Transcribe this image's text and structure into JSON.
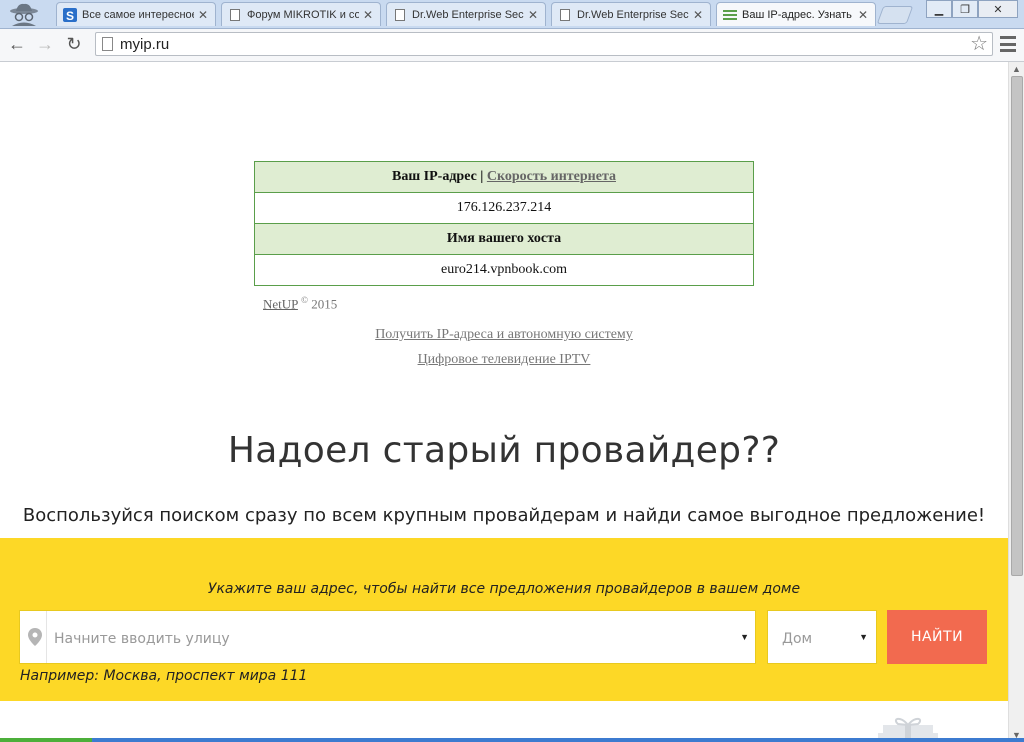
{
  "browser": {
    "tabs": [
      {
        "label": "Все самое интересное",
        "icon": "s-logo-icon",
        "active": false
      },
      {
        "label": "Форум MIKROTIK и со",
        "icon": "page-icon",
        "active": false
      },
      {
        "label": "Dr.Web Enterprise Sec",
        "icon": "page-icon",
        "active": false
      },
      {
        "label": "Dr.Web Enterprise Sec",
        "icon": "page-icon",
        "active": false
      },
      {
        "label": "Ваш IP-адрес. Узнать",
        "icon": "myip-favicon",
        "active": true
      }
    ],
    "url": "myip.ru"
  },
  "ip_table": {
    "your_ip_label": "Ваш IP-адрес |",
    "speed_link": "Скорость интернета",
    "ip_value": "176.126.237.214",
    "host_label": "Имя вашего хоста",
    "host_value": "euro214.vpnbook.com"
  },
  "footer": {
    "brand": "NetUP",
    "copyright": "©",
    "year": "2015"
  },
  "links": {
    "ip_as": "Получить IP-адреса и автономную систему",
    "iptv": "Цифровое телевидение IPTV"
  },
  "promo": {
    "headline": "Надоел старый провайдер??",
    "subline": "Воспользуйся поиском сразу по всем крупным провайдерам и найди самое выгодное предложение!",
    "hint": "Укажите ваш адрес, чтобы найти все предложения провайдеров в вашем доме",
    "street_placeholder": "Начните вводить улицу",
    "house_placeholder": "Дом",
    "button": "НАЙТИ",
    "example": "Например: Москва, проспект мира 111",
    "colors": {
      "banner": "#fdd826",
      "button": "#f26a4f",
      "table_header": "#dfedd2"
    }
  }
}
